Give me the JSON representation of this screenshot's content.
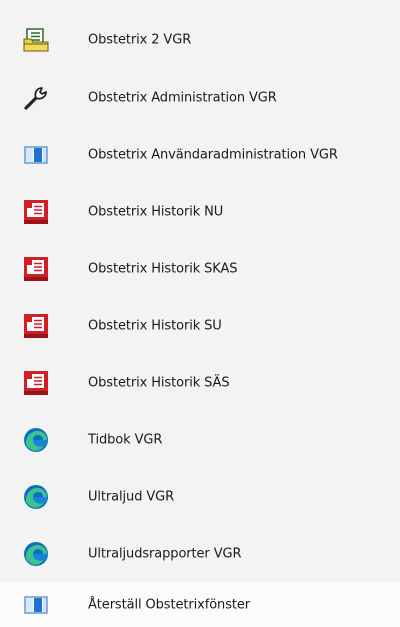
{
  "menu": {
    "items": [
      {
        "label": "Obstetrix 2 VGR",
        "icon": "folder-document-icon"
      },
      {
        "label": "Obstetrix Administration VGR",
        "icon": "wrench-icon"
      },
      {
        "label": "Obstetrix Användaradministration VGR",
        "icon": "window-icon"
      },
      {
        "label": "Obstetrix Historik NU",
        "icon": "red-document-icon"
      },
      {
        "label": "Obstetrix Historik SKAS",
        "icon": "red-document-icon"
      },
      {
        "label": "Obstetrix Historik SU",
        "icon": "red-document-icon"
      },
      {
        "label": "Obstetrix Historik SÄS",
        "icon": "red-document-icon"
      },
      {
        "label": "Tidbok VGR",
        "icon": "edge-browser-icon"
      },
      {
        "label": "Ultraljud VGR",
        "icon": "edge-browser-icon"
      },
      {
        "label": "Ultraljudsrapporter VGR",
        "icon": "edge-browser-icon"
      },
      {
        "label": "Återställ Obstetrixfönster",
        "icon": "window-icon"
      }
    ]
  },
  "colors": {
    "background": "#f3f3f3",
    "highlight": "#fbfbfb",
    "text": "#1a1a1a",
    "red_icon": "#d21f26",
    "edge_blue": "#0c6fc5",
    "edge_green": "#3cc38a"
  }
}
